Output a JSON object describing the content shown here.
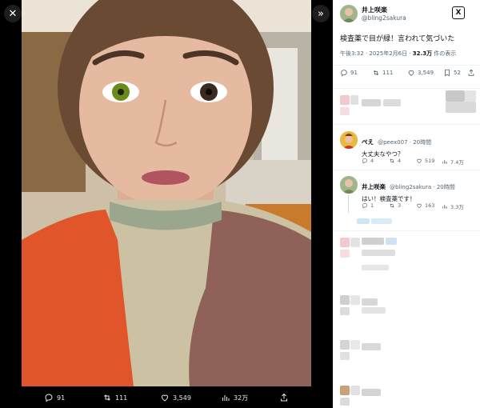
{
  "viewer": {
    "close_icon": "✕",
    "collapse_icon": "»",
    "actions": {
      "replies": "91",
      "retweets": "111",
      "likes": "3,549",
      "views": "32万"
    }
  },
  "tweet": {
    "author_name": "井上咲楽",
    "author_handle": "@bling2sakura",
    "logo": "X",
    "text": "検査薬で目が緑！言われて気づいた",
    "time": "午後3:32 · 2025年2月6日 · ",
    "views_count": "32.3万",
    "views_suffix": " 件の表示",
    "stats": {
      "replies": "91",
      "retweets": "111",
      "likes": "3,549",
      "bookmarks": "52"
    }
  },
  "replies": [
    {
      "name": "ぺえ",
      "meta": "@peex007 · 20時間",
      "text": "大丈夫なやつ？",
      "replies": "4",
      "retweets": "4",
      "likes": "519",
      "views": "7.4万"
    },
    {
      "name": "井上咲楽",
      "meta": "@bling2sakura · 20時間",
      "text": "はい！検査薬です！",
      "replies": "1",
      "retweets": "3",
      "likes": "163",
      "views": "3.3万"
    }
  ],
  "colors": {
    "background": "#000000",
    "panel": "#ffffff",
    "secondary_text": "#536471",
    "link": "#1d9bf0"
  }
}
